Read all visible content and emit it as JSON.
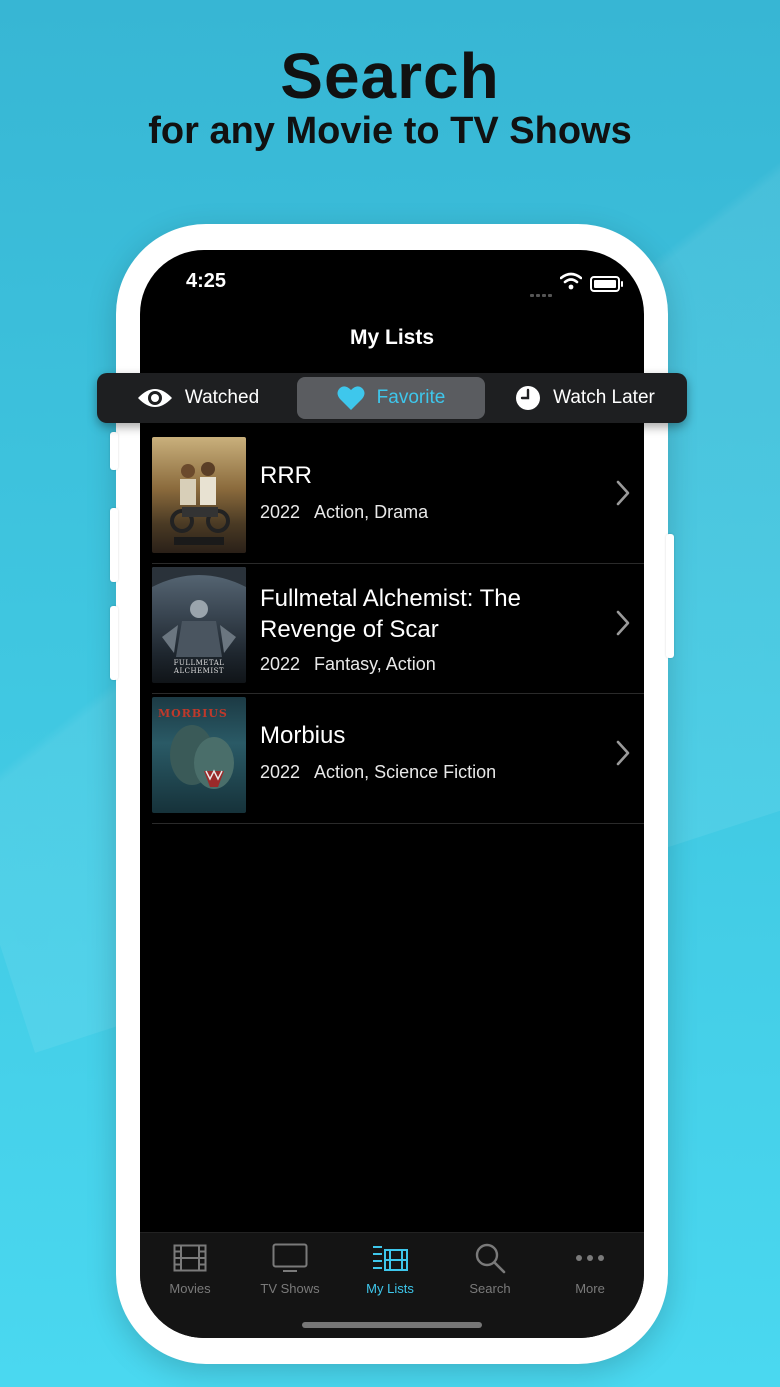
{
  "headline": {
    "title": "Search",
    "subtitle": "for any Movie to TV Shows"
  },
  "status_bar": {
    "time": "4:25"
  },
  "nav": {
    "title": "My Lists"
  },
  "segments": [
    {
      "label": "Watched",
      "icon": "eye-icon",
      "selected": false
    },
    {
      "label": "Favorite",
      "icon": "heart-icon",
      "selected": true
    },
    {
      "label": "Watch Later",
      "icon": "clock-icon",
      "selected": false
    }
  ],
  "items": [
    {
      "title": "RRR",
      "year": "2022",
      "genres": "Action, Drama"
    },
    {
      "title": "Fullmetal Alchemist: The Revenge of Scar",
      "year": "2022",
      "genres": "Fantasy, Action",
      "poster_text": "FULLMETAL ALCHEMIST"
    },
    {
      "title": "Morbius",
      "year": "2022",
      "genres": "Action, Science Fiction",
      "poster_text": "MORBIUS"
    }
  ],
  "tabs": [
    {
      "label": "Movies",
      "icon": "film-icon",
      "active": false
    },
    {
      "label": "TV Shows",
      "icon": "tv-icon",
      "active": false
    },
    {
      "label": "My Lists",
      "icon": "list-icon",
      "active": true
    },
    {
      "label": "Search",
      "icon": "search-icon",
      "active": false
    },
    {
      "label": "More",
      "icon": "more-icon",
      "active": false
    }
  ],
  "colors": {
    "accent": "#3ec7ec",
    "background_top": "#37b6d4",
    "background_bottom": "#4ad8f0"
  }
}
